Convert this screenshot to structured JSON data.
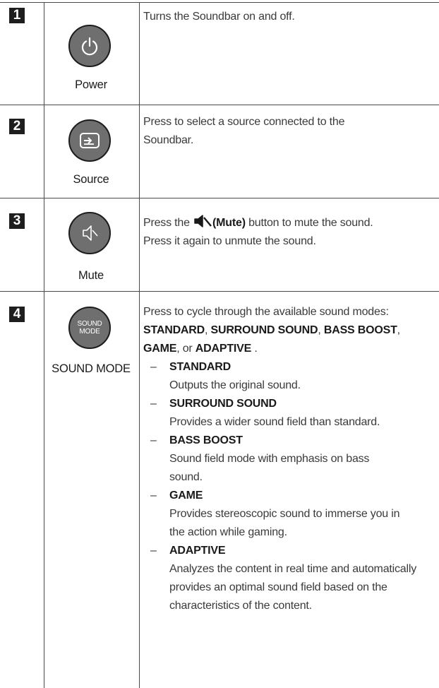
{
  "rows": [
    {
      "number": "1",
      "icon": "power-icon",
      "label": "Power",
      "description": "Turns the Soundbar on and off."
    },
    {
      "number": "2",
      "icon": "source-input-icon",
      "label": "Source",
      "description": "Press to select a source connected to the Soundbar."
    },
    {
      "number": "3",
      "icon": "mute-speaker-icon",
      "label": "Mute",
      "description_before": "Press the",
      "description_bold": "(Mute)",
      "description_after": "button to mute the sound.",
      "description_line2": "Press it again to unmute the sound."
    },
    {
      "number": "4",
      "button_text": [
        "SOUND",
        "MODE"
      ],
      "label": "SOUND MODE",
      "intro": "Press to cycle through the available sound modes:",
      "mode_list": {
        "m1": "STANDARD",
        "sep1": ",",
        "m2": "SURROUND SOUND",
        "sep2": ",",
        "m3": "BASS BOOST",
        "sep3": ",",
        "m4": "GAME",
        "sep4": ", or",
        "m5": "ADAPTIVE",
        "end": "."
      },
      "modes": [
        {
          "name": "STANDARD",
          "desc": "Outputs the original sound."
        },
        {
          "name": "SURROUND SOUND",
          "desc": "Provides a wider sound field than standard."
        },
        {
          "name": "BASS BOOST",
          "desc": "Sound field mode with emphasis on bass sound."
        },
        {
          "name": "GAME",
          "desc": "Provides stereoscopic sound to immerse you in the action while gaming."
        },
        {
          "name": "ADAPTIVE",
          "desc": "Analyzes the content in real time and automatically provides an optimal sound field based on the characteristics of the content."
        }
      ],
      "dash": "–"
    }
  ]
}
